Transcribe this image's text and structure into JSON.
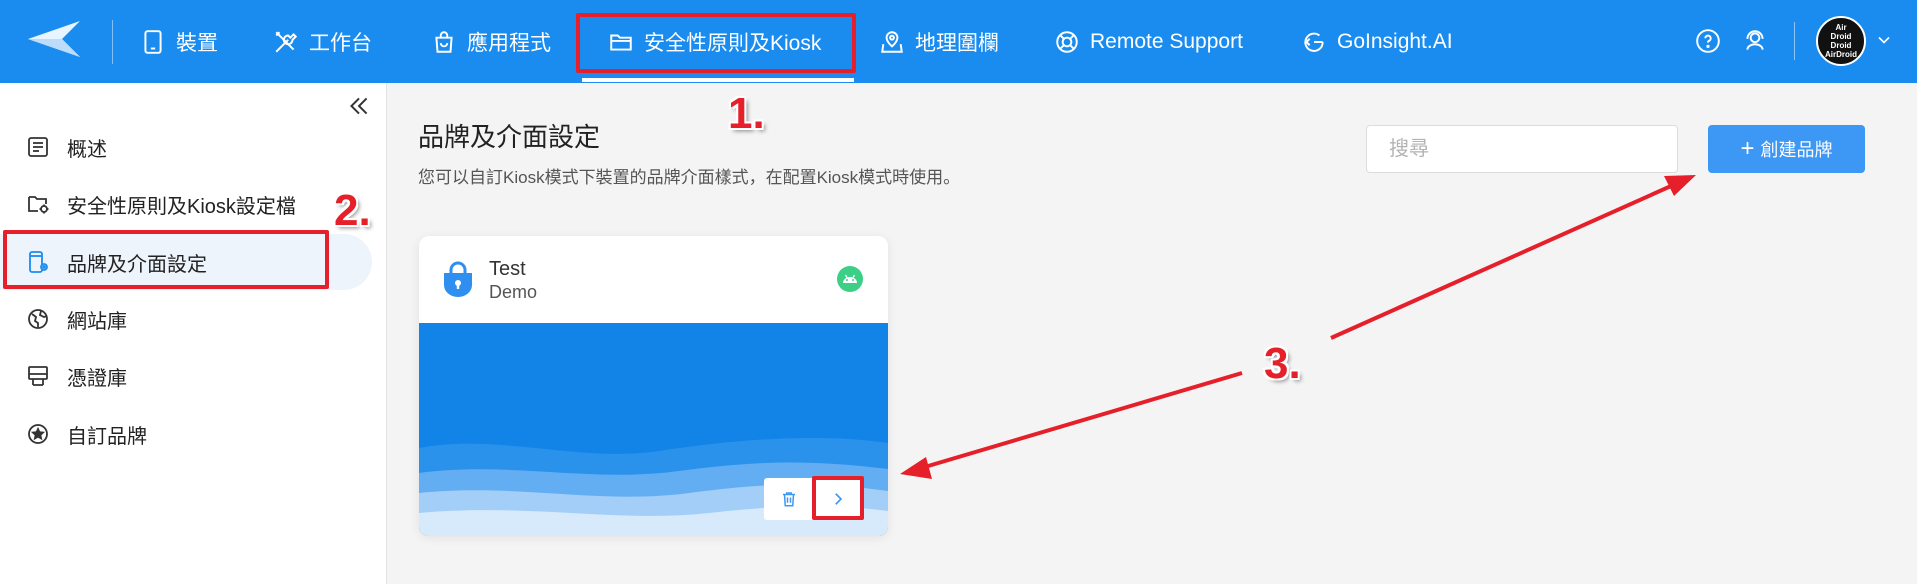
{
  "nav": {
    "items": [
      {
        "label": "裝置",
        "icon": "tablet-icon"
      },
      {
        "label": "工作台",
        "icon": "tools-icon"
      },
      {
        "label": "應用程式",
        "icon": "shopping-bag-icon"
      },
      {
        "label": "安全性原則及Kiosk",
        "icon": "folder-icon",
        "active": true
      },
      {
        "label": "地理圍欄",
        "icon": "map-pin-icon"
      },
      {
        "label": "Remote Support",
        "icon": "lifebuoy-icon"
      },
      {
        "label": "GoInsight.AI",
        "icon": "goinsight-icon"
      }
    ],
    "help_icon": "question-circle-icon",
    "support_icon": "headset-icon",
    "avatar_lines": [
      "Air",
      "Droid",
      "Droid",
      "AirDroid"
    ]
  },
  "sidebar": {
    "items": [
      {
        "label": "概述",
        "icon": "list-icon"
      },
      {
        "label": "安全性原則及Kiosk設定檔",
        "icon": "folder-settings-icon"
      },
      {
        "label": "品牌及介面設定",
        "icon": "device-settings-icon",
        "active": true
      },
      {
        "label": "網站庫",
        "icon": "globe-icon"
      },
      {
        "label": "憑證庫",
        "icon": "certificate-icon"
      },
      {
        "label": "自訂品牌",
        "icon": "star-circle-icon"
      }
    ]
  },
  "main": {
    "title": "品牌及介面設定",
    "description": "您可以自訂Kiosk模式下裝置的品牌介面樣式，在配置Kiosk模式時使用。",
    "search_placeholder": "搜尋",
    "create_button_label": "創建品牌",
    "create_button_icon": "plus-icon"
  },
  "card": {
    "name": "Test",
    "subtitle": "Demo",
    "platform_icon": "android-icon",
    "preview_color": "#1284e8",
    "actions": [
      "trash-icon",
      "chevron-right-icon"
    ]
  },
  "annotations": {
    "step1": "1.",
    "step2": "2.",
    "step3": "3.",
    "color": "#e5202a"
  },
  "colors": {
    "topbar": "#1a8cf0",
    "accent": "#3d97f5",
    "android": "#3ccf86"
  }
}
